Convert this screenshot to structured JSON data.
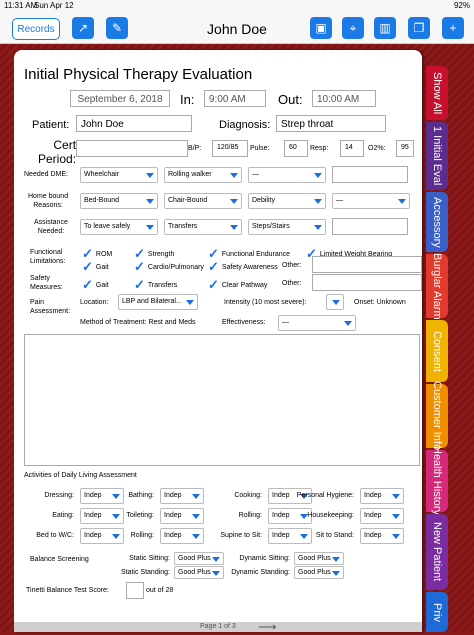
{
  "status": {
    "time": "11:31 AM",
    "date": "Sun Apr 12",
    "battery": "92%"
  },
  "nav": {
    "records": "Records",
    "title": "John Doe"
  },
  "form": {
    "title": "Initial Physical Therapy Evaluation",
    "date": "September 6, 2018",
    "in_label": "In:",
    "in_time": "9:00 AM",
    "out_label": "Out:",
    "out_time": "10:00 AM",
    "patient_label": "Patient:",
    "patient": "John Doe",
    "diagnosis_label": "Diagnosis:",
    "diagnosis": "Strep throat",
    "cert_label": "Cert\nPeriod:",
    "bp_label": "B/P:",
    "bp": "120/85",
    "pulse_label": "Pulse:",
    "pulse": "60",
    "resp_label": "Resp:",
    "resp": "14",
    "o2_label": "O2%:",
    "o2": "95",
    "dme_label": "Needed DME:",
    "dme": [
      "Wheelchair",
      "Rolling walker",
      "—",
      ""
    ],
    "homebound_label": "Home bound\nReasons:",
    "homebound": [
      "Bed-Bound",
      "Chair-Bound",
      "Debility",
      "—"
    ],
    "assist_label": "Assistance\nNeeded:",
    "assist": [
      "To leave safely",
      "Transfers",
      "Steps/Stairs",
      ""
    ],
    "func_label": "Functional\nLimitations:",
    "func": [
      "ROM",
      "Strength",
      "Functional Endurance",
      "Limited Weight Bearing",
      "Gait",
      "Cardio/Pulmonary",
      "Safety Awareness"
    ],
    "other_label": "Other:",
    "safety_label": "Safety\nMeasures:",
    "safety": [
      "Gait",
      "Transfers",
      "Clear Pathway"
    ],
    "pain_label": "Pain\nAssessment:",
    "location_label": "Location:",
    "location": "LBP and Bilateral...",
    "intensity_label": "Intensity (10 most severe):",
    "onset": "Onset: Unknown",
    "method": "Method of Treatment: Rest and Meds",
    "effect_label": "Effectiveness:",
    "effect": "—",
    "adl_title": "Activities of Daily Living Assessment",
    "adl": [
      {
        "l": "Dressing:",
        "v": "Indep"
      },
      {
        "l": "Bathing:",
        "v": "Indep"
      },
      {
        "l": "Cooking:",
        "v": "Indep"
      },
      {
        "l": "Personal Hygiene:",
        "v": "Indep"
      },
      {
        "l": "Eating:",
        "v": "Indep"
      },
      {
        "l": "Toileting:",
        "v": "Indep"
      },
      {
        "l": "Rolling:",
        "v": "Indep"
      },
      {
        "l": "Housekeeping:",
        "v": "Indep"
      },
      {
        "l": "Bed to W/C:",
        "v": "Indep"
      },
      {
        "l": "Rolling:",
        "v": "Indep"
      },
      {
        "l": "Supine to Sit:",
        "v": "Indep"
      },
      {
        "l": "Sit to Stand:",
        "v": "Indep"
      }
    ],
    "balance_label": "Balance Screening",
    "bal": [
      {
        "l": "Static Sitting:",
        "v": "Good Plus"
      },
      {
        "l": "Dynamic Sitting:",
        "v": "Good Plus"
      },
      {
        "l": "Static Standing:",
        "v": "Good Plus"
      },
      {
        "l": "Dynamic Standing:",
        "v": "Good Plus"
      }
    ],
    "tinetti_label": "Tinetti Balance Test Score:",
    "tinetti_of": "out of 28",
    "page": "Page 1 of 3"
  },
  "tabs": [
    {
      "label": "Show All",
      "color": "#c8102e"
    },
    {
      "label": "1 Initial Eval",
      "color": "#5b2d8e"
    },
    {
      "label": "Accessory",
      "color": "#3a5fc8"
    },
    {
      "label": "Burglar Alarm",
      "color": "#e23b2e"
    },
    {
      "label": "Consent",
      "color": "#f0b400"
    },
    {
      "label": "Customer Info",
      "color": "#f09000"
    },
    {
      "label": "Health History",
      "color": "#d52a7a"
    },
    {
      "label": "New Patient",
      "color": "#7a2da0"
    },
    {
      "label": "Priv",
      "color": "#1e6ad8"
    }
  ]
}
